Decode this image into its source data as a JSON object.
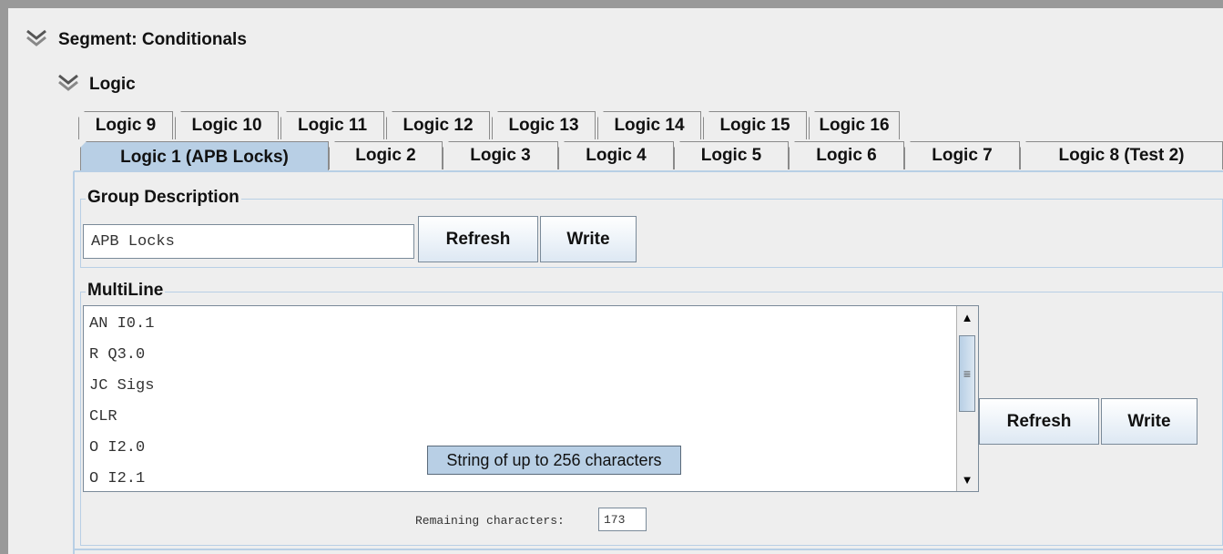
{
  "segment": {
    "title": "Segment: Conditionals"
  },
  "logic": {
    "title": "Logic"
  },
  "tabs_row_top": [
    "Logic 9",
    "Logic 10",
    "Logic 11",
    "Logic 12",
    "Logic 13",
    "Logic 14",
    "Logic 15",
    "Logic 16"
  ],
  "tabs_row_bottom": [
    "Logic 1 (APB Locks)",
    "Logic 2",
    "Logic 3",
    "Logic 4",
    "Logic 5",
    "Logic 6",
    "Logic 7",
    "Logic 8 (Test 2)"
  ],
  "selected_tab": "Logic 1 (APB Locks)",
  "group_description": {
    "legend": "Group Description",
    "value": "APB Locks",
    "refresh_label": "Refresh",
    "write_label": "Write"
  },
  "multiline": {
    "legend": "MultiLine",
    "lines": [
      "AN I0.1",
      "R Q3.0",
      "JC Sigs",
      "CLR",
      "O I2.0",
      "O I2.1"
    ],
    "refresh_label": "Refresh",
    "write_label": "Write",
    "tooltip": "String of up to 256 characters",
    "remaining_label": "Remaining characters:",
    "remaining_value": "173"
  },
  "icons": {
    "expand": "chevron-double-down-icon",
    "scroll_up": "arrow-up-icon",
    "scroll_down": "arrow-down-icon",
    "grip": "grip-icon"
  },
  "colors": {
    "selected_tab": "#b8cfe5",
    "background": "#eeeeee",
    "border": "#999999"
  }
}
